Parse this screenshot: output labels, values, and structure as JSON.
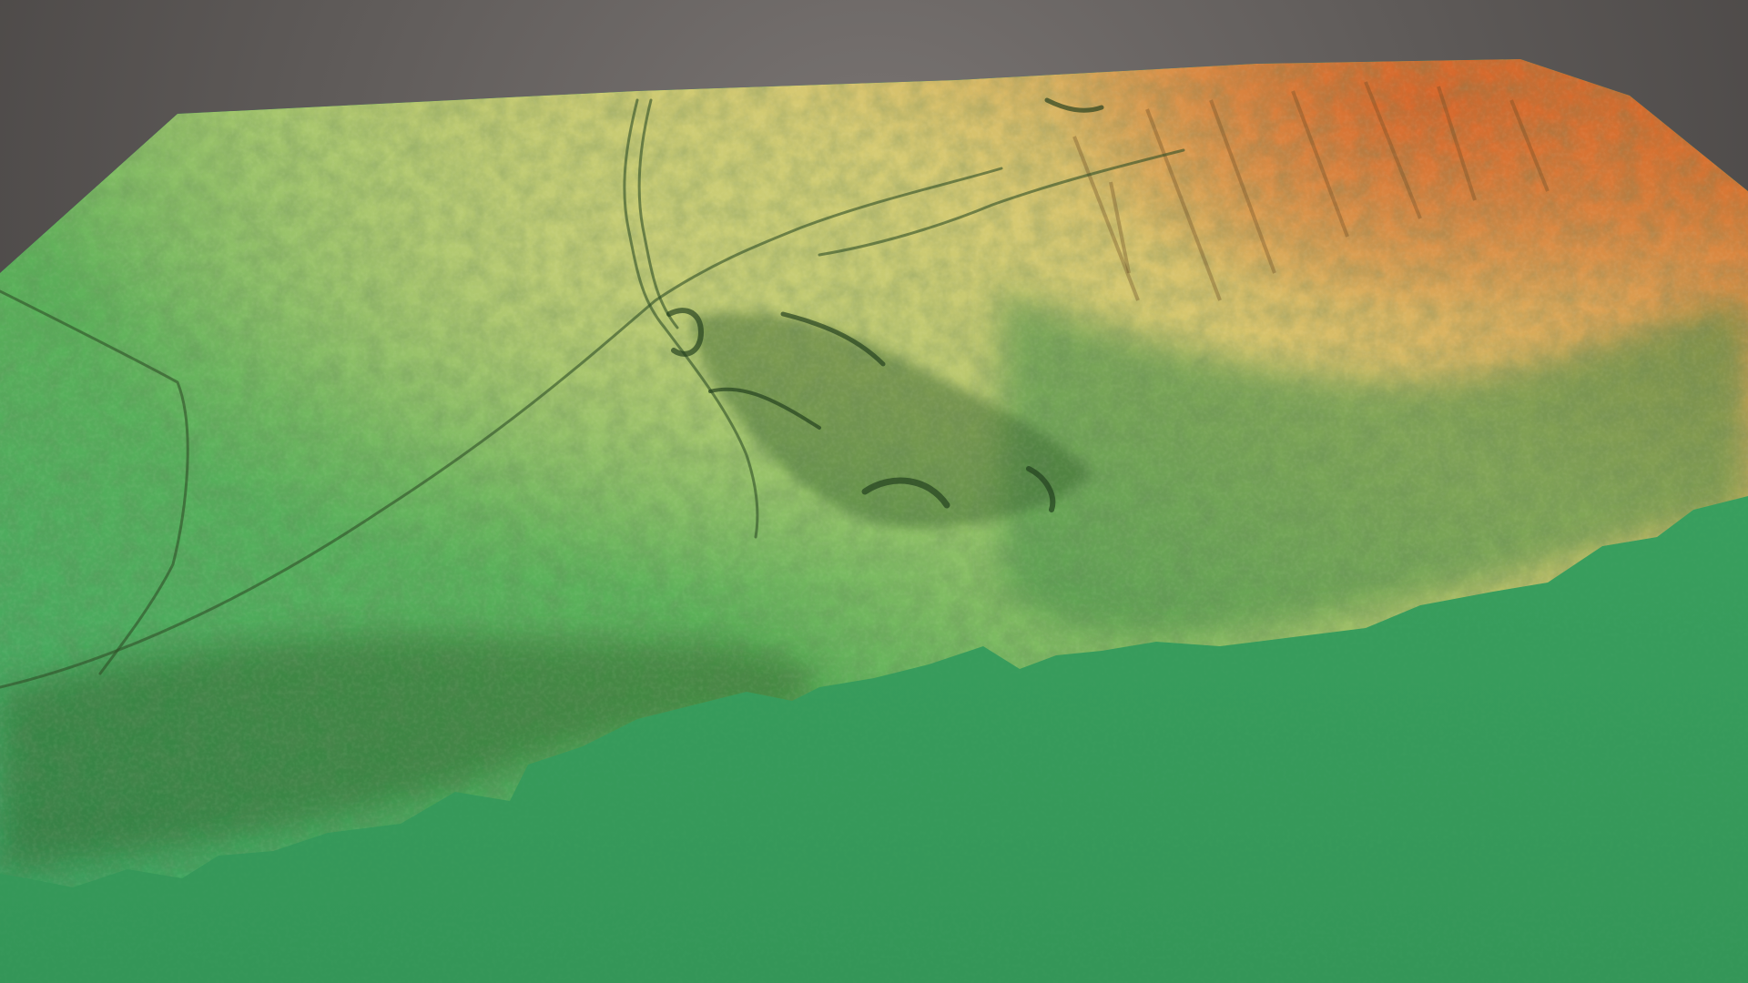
{
  "scene": {
    "type": "3d-terrain-elevation-model",
    "colors": {
      "background_top": "#7a7573",
      "background_bottom": "#3f3c3b",
      "elevation_low": "#3ba563",
      "elevation_lowmid": "#5cb25a",
      "elevation_mid": "#a6c56a",
      "elevation_high": "#dcc46c",
      "elevation_peak": "#d9742e",
      "hillshade_dark": "#1e3a1c"
    }
  }
}
